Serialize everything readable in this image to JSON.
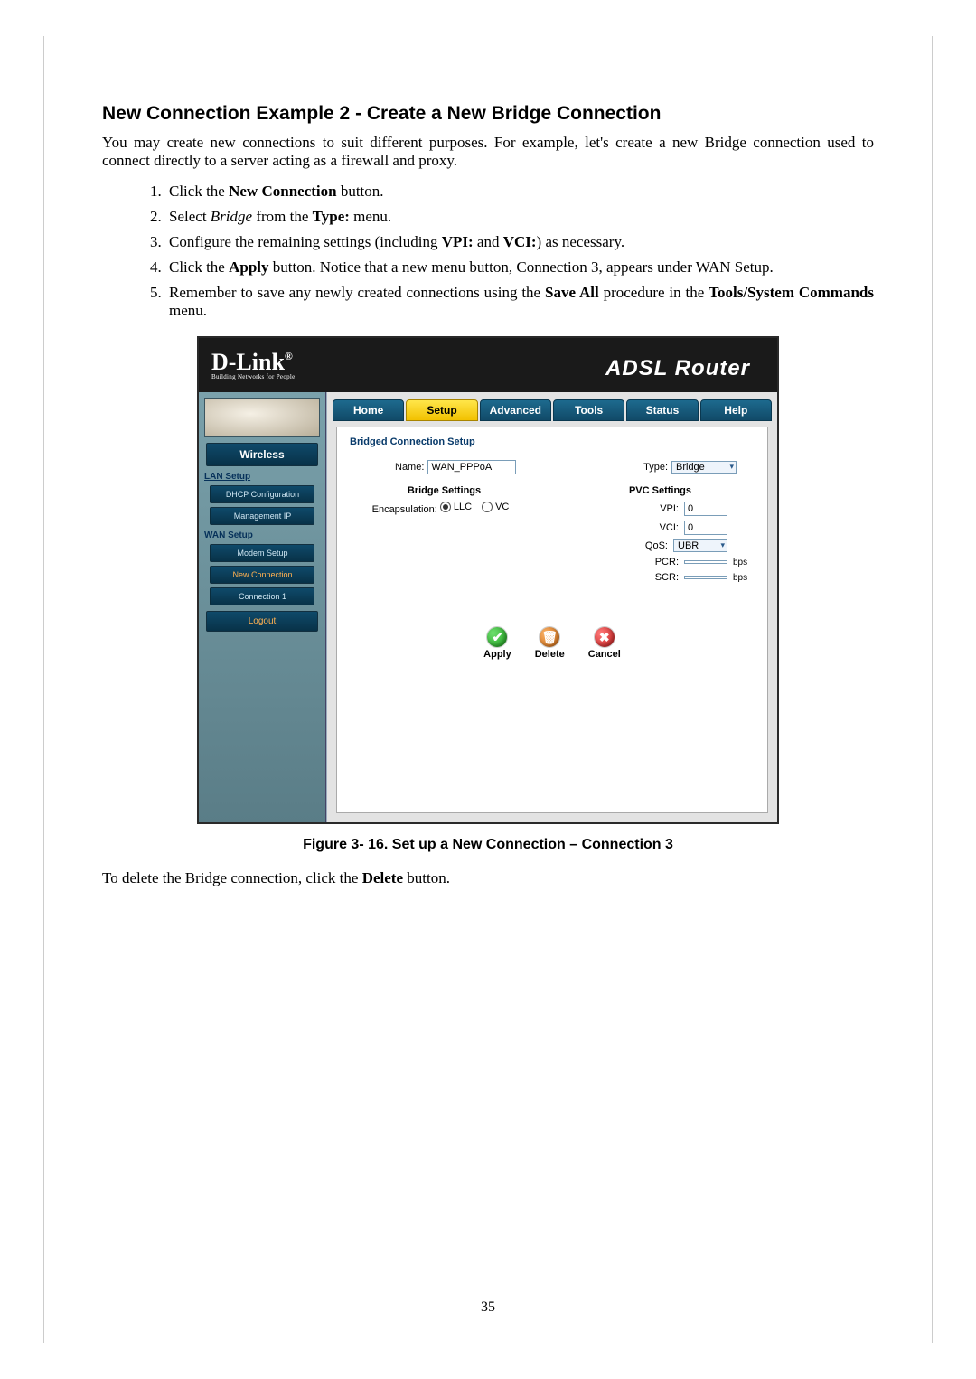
{
  "section_title": "New Connection Example 2 - Create a New Bridge Connection",
  "intro": "You may create new connections to suit different purposes. For example, let's create a new Bridge connection used to connect directly to a server acting as a firewall and proxy.",
  "steps": {
    "s1_a": "Click the ",
    "s1_b": "New Connection",
    "s1_c": " button.",
    "s2_a": "Select ",
    "s2_b": "Bridge",
    "s2_c": " from the ",
    "s2_d": "Type:",
    "s2_e": " menu.",
    "s3_a": "Configure the remaining settings (including ",
    "s3_b": "VPI:",
    "s3_c": " and ",
    "s3_d": "VCI:",
    "s3_e": ") as necessary.",
    "s4_a": "Click the ",
    "s4_b": "Apply",
    "s4_c": " button. Notice that a new menu button, Connection 3, appears under WAN Setup.",
    "s5_a": "Remember to save any newly created connections using the ",
    "s5_b": "Save All",
    "s5_c": " procedure in the ",
    "s5_d": "Tools/System Commands",
    "s5_e": " menu."
  },
  "router": {
    "brand": "D-Link",
    "brand_tag": "Building Networks for People",
    "title": "ADSL Router",
    "tabs": {
      "home": "Home",
      "setup": "Setup",
      "advanced": "Advanced",
      "tools": "Tools",
      "status": "Status",
      "help": "Help"
    },
    "side": {
      "wireless": "Wireless",
      "lan_group": "LAN Setup",
      "dhcp": "DHCP Configuration",
      "mgmt": "Management IP",
      "wan_group": "WAN Setup",
      "modem": "Modem Setup",
      "newconn": "New Connection",
      "conn1": "Connection 1",
      "logout": "Logout"
    },
    "panel": {
      "heading": "Bridged Connection Setup",
      "name_label": "Name:",
      "name_value": "WAN_PPPoA",
      "type_label": "Type:",
      "type_value": "Bridge",
      "bridge_heading": "Bridge Settings",
      "encap_label": "Encapsulation:",
      "encap_llc": "LLC",
      "encap_vc": "VC",
      "pvc_heading": "PVC Settings",
      "vpi_label": "VPI:",
      "vpi_value": "0",
      "vci_label": "VCI:",
      "vci_value": "0",
      "qos_label": "QoS:",
      "qos_value": "UBR",
      "pcr_label": "PCR:",
      "pcr_unit": "bps",
      "scr_label": "SCR:",
      "scr_unit": "bps",
      "apply": "Apply",
      "delete": "Delete",
      "cancel": "Cancel"
    }
  },
  "caption": "Figure 3- 16. Set up a New Connection – Connection 3",
  "outro_a": "To delete the Bridge connection, click the ",
  "outro_b": "Delete",
  "outro_c": " button.",
  "page_number": "35"
}
